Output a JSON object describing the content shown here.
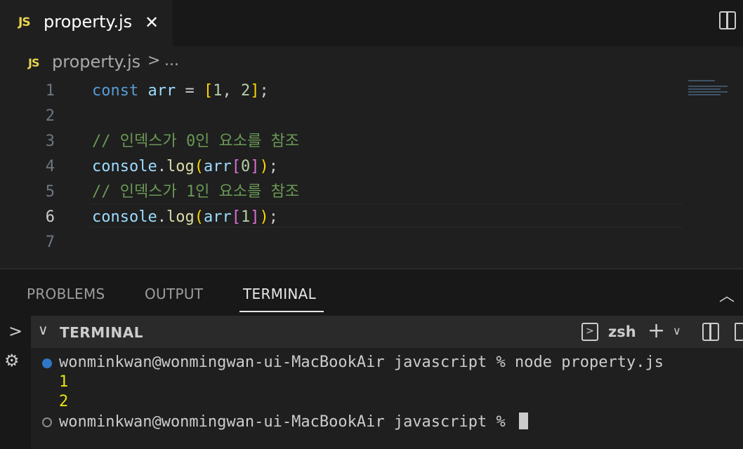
{
  "tab": {
    "icon_label": "JS",
    "filename": "property.js",
    "close_label": "✕"
  },
  "breadcrumb": {
    "icon_label": "JS",
    "file": "property.js",
    "separator": ">",
    "ellipsis": "..."
  },
  "editor": {
    "line_numbers": [
      "1",
      "2",
      "3",
      "4",
      "5",
      "6",
      "7"
    ],
    "active_line": "6",
    "comments": {
      "line3": "// 인덱스가 0인 요소를 참조",
      "line5": "// 인덱스가 1인 요소를 참조"
    }
  },
  "panel": {
    "tabs": {
      "problems": "PROBLEMS",
      "output": "OUTPUT",
      "terminal": "TERMINAL"
    },
    "active_tab": "TERMINAL",
    "terminal_header": {
      "title": "TERMINAL",
      "shell": "zsh"
    }
  },
  "terminal": {
    "lines": [
      "wonminkwan@wonmingwan-ui-MacBookAir javascript % node property.js",
      "1",
      "2",
      "wonminkwan@wonmingwan-ui-MacBookAir javascript % "
    ]
  },
  "colors": {
    "accent": "#3794ff",
    "output": "#e5e510",
    "comment": "#6a9955",
    "keyword": "#569cd6"
  },
  "icons": [
    "js-file-icon",
    "close-icon",
    "split-editor-icon",
    "chevron-right-icon",
    "chevron-up-icon",
    "chevron-down-icon",
    "terminal-prompt-icon",
    "plus-icon",
    "trash-icon",
    "debug-icon"
  ]
}
